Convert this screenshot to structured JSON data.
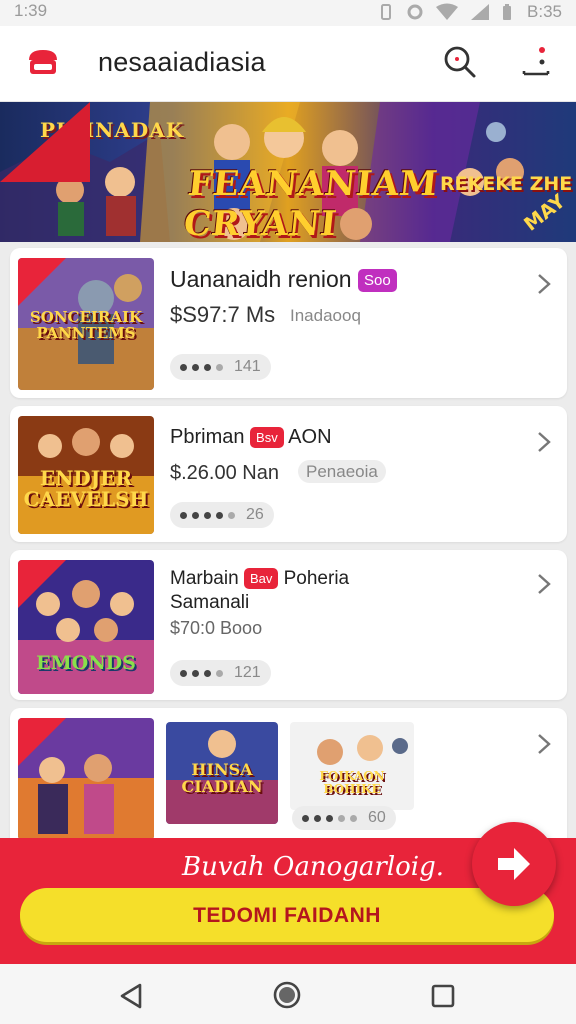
{
  "status_bar": {
    "time": "1:39",
    "right_time": "B:35"
  },
  "header": {
    "title": "nesaaiadiasia"
  },
  "banner": {
    "title_small": "PIDINADAK",
    "title_main": "FEANANIAM CRYANI",
    "title_right": "REKEKE ZHE",
    "corner_text": "MAY"
  },
  "cards": [
    {
      "thumb_text": "SONCEIRAIK PANNTEMS",
      "title": "Uananaidh renion",
      "badge": "Soo",
      "badge_color": "#c02fbf",
      "price": "$S97:7 Ms",
      "subtitle": "Inadaooq",
      "count": "141"
    },
    {
      "thumb_text": "ENDJER CAEVELSH",
      "title_prefix": "Pbriman",
      "badge": "Bsv",
      "badge_color": "#e8243a",
      "title_suffix": "AON",
      "price": "$.26.00 Nan",
      "subtitle": "Penaeoia",
      "count": "26"
    },
    {
      "thumb_text": "EMONDS",
      "title_prefix": "Marbain",
      "badge": "Bav",
      "badge_color": "#e8243a",
      "title_suffix": "Poheria",
      "title_line2": "Samanali",
      "price": "$70:0 Booo",
      "count": "121"
    },
    {
      "thumb_text": "",
      "extra_thumb_1_text": "HINSA CIADIAN",
      "extra_thumb_2_text": "FOIKAON BOHIKE",
      "count": "60"
    }
  ],
  "promo": {
    "text": "Buvah Oanogarloig.",
    "button_label": "TEDOMI FAIDANH"
  },
  "colors": {
    "accent": "#e8243a",
    "button": "#f5df2a"
  },
  "icons": [
    "logo-icon",
    "search-icon",
    "more-icon",
    "chevron-right-icon",
    "arrow-right-icon",
    "back-icon",
    "home-icon",
    "recent-icon"
  ]
}
